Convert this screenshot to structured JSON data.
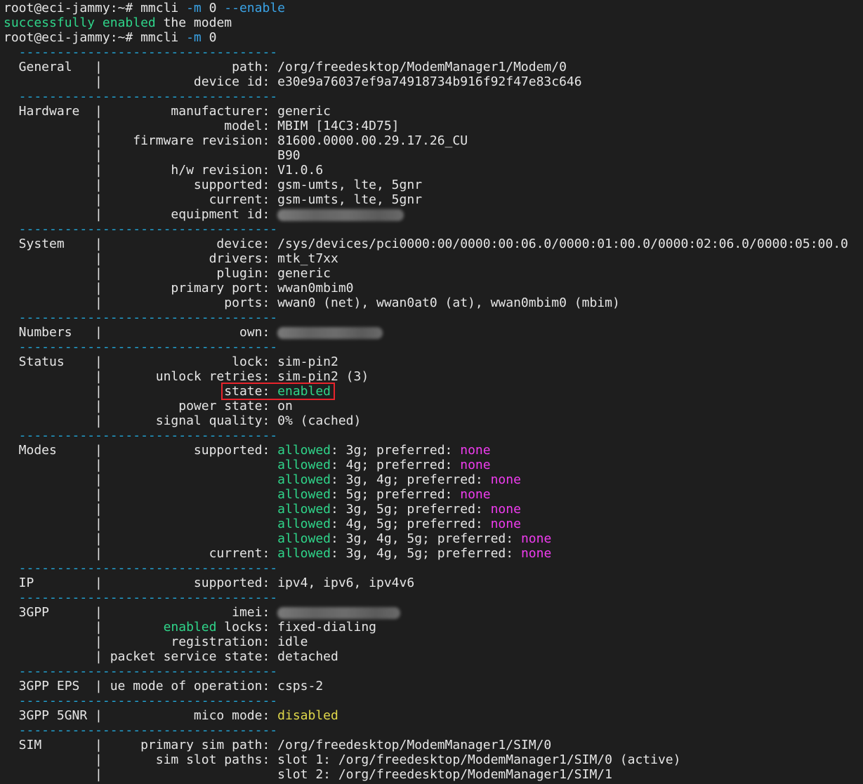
{
  "window": {
    "type": "terminal"
  },
  "colors": {
    "background": "#1e1e1e",
    "text": "#e6e6e6",
    "separator": "#22a5d6",
    "green": "#2fd58a",
    "blue": "#3aa3e6",
    "magenta": "#f03cf0",
    "yellow": "#e0d84a",
    "highlight_box": "#e8242c"
  },
  "separator_text": "  ----------------------------------",
  "lines": [
    {
      "s": [
        {
          "t": "root@eci-jammy:~# mmcli ",
          "c": "default"
        },
        {
          "t": "-m",
          "c": "blue"
        },
        {
          "t": " 0 ",
          "c": "default"
        },
        {
          "t": "--enable",
          "c": "blue"
        }
      ]
    },
    {
      "s": [
        {
          "t": "successfully enabled",
          "c": "green"
        },
        {
          "t": " the modem",
          "c": "default"
        }
      ]
    },
    {
      "s": [
        {
          "t": "root@eci-jammy:~# mmcli ",
          "c": "default"
        },
        {
          "t": "-m",
          "c": "blue"
        },
        {
          "t": " 0",
          "c": "default"
        }
      ]
    },
    {
      "sep": true
    },
    {
      "s": [
        {
          "t": "  General   |                 path: /org/freedesktop/ModemManager1/Modem/0",
          "c": "default"
        }
      ]
    },
    {
      "s": [
        {
          "t": "            |            device id: e30e9a76037ef9a74918734b916f92f47e83c646",
          "c": "default"
        }
      ]
    },
    {
      "sep": true
    },
    {
      "s": [
        {
          "t": "  Hardware  |         manufacturer: generic",
          "c": "default"
        }
      ]
    },
    {
      "s": [
        {
          "t": "            |                model: MBIM [14C3:4D75]",
          "c": "default"
        }
      ]
    },
    {
      "s": [
        {
          "t": "            |    firmware revision: 81600.0000.00.29.17.26_CU",
          "c": "default"
        }
      ]
    },
    {
      "s": [
        {
          "t": "            |                       B90",
          "c": "default"
        }
      ]
    },
    {
      "s": [
        {
          "t": "            |         h/w revision: V1.0.6",
          "c": "default"
        }
      ]
    },
    {
      "s": [
        {
          "t": "            |            supported: gsm-umts, lte, 5gnr",
          "c": "default"
        }
      ]
    },
    {
      "s": [
        {
          "t": "            |              current: gsm-umts, lte, 5gnr",
          "c": "default"
        }
      ]
    },
    {
      "s": [
        {
          "t": "            |         equipment id: ",
          "c": "default"
        },
        {
          "redact": true,
          "w": 180
        }
      ]
    },
    {
      "sep": true
    },
    {
      "s": [
        {
          "t": "  System    |               device: /sys/devices/pci0000:00/0000:00:06.0/0000:01:00.0/0000:02:06.0/0000:05:00.0",
          "c": "default"
        }
      ]
    },
    {
      "s": [
        {
          "t": "            |              drivers: mtk_t7xx",
          "c": "default"
        }
      ]
    },
    {
      "s": [
        {
          "t": "            |               plugin: generic",
          "c": "default"
        }
      ]
    },
    {
      "s": [
        {
          "t": "            |         primary port: wwan0mbim0",
          "c": "default"
        }
      ]
    },
    {
      "s": [
        {
          "t": "            |                ports: wwan0 (net), wwan0at0 (at), wwan0mbim0 (mbim)",
          "c": "default"
        }
      ]
    },
    {
      "sep": true
    },
    {
      "s": [
        {
          "t": "  Numbers   |                  own: ",
          "c": "default"
        },
        {
          "redact": true,
          "w": 150
        }
      ]
    },
    {
      "sep": true
    },
    {
      "s": [
        {
          "t": "  Status    |                 lock: sim-pin2",
          "c": "default"
        }
      ]
    },
    {
      "s": [
        {
          "t": "            |       unlock retries: sim-pin2 (3)",
          "c": "default"
        }
      ]
    },
    {
      "s": [
        {
          "t": "            |                state: ",
          "c": "default"
        },
        {
          "t": "enabled",
          "c": "green"
        }
      ],
      "highlight": true
    },
    {
      "s": [
        {
          "t": "            |          power state: on",
          "c": "default"
        }
      ]
    },
    {
      "s": [
        {
          "t": "            |       signal quality: 0% (cached)",
          "c": "default"
        }
      ]
    },
    {
      "sep": true
    },
    {
      "s": [
        {
          "t": "  Modes     |            supported: ",
          "c": "default"
        },
        {
          "t": "allowed",
          "c": "green"
        },
        {
          "t": ": 3g; preferred: ",
          "c": "default"
        },
        {
          "t": "none",
          "c": "magenta"
        }
      ]
    },
    {
      "s": [
        {
          "t": "            |                       ",
          "c": "default"
        },
        {
          "t": "allowed",
          "c": "green"
        },
        {
          "t": ": 4g; preferred: ",
          "c": "default"
        },
        {
          "t": "none",
          "c": "magenta"
        }
      ]
    },
    {
      "s": [
        {
          "t": "            |                       ",
          "c": "default"
        },
        {
          "t": "allowed",
          "c": "green"
        },
        {
          "t": ": 3g, 4g; preferred: ",
          "c": "default"
        },
        {
          "t": "none",
          "c": "magenta"
        }
      ]
    },
    {
      "s": [
        {
          "t": "            |                       ",
          "c": "default"
        },
        {
          "t": "allowed",
          "c": "green"
        },
        {
          "t": ": 5g; preferred: ",
          "c": "default"
        },
        {
          "t": "none",
          "c": "magenta"
        }
      ]
    },
    {
      "s": [
        {
          "t": "            |                       ",
          "c": "default"
        },
        {
          "t": "allowed",
          "c": "green"
        },
        {
          "t": ": 3g, 5g; preferred: ",
          "c": "default"
        },
        {
          "t": "none",
          "c": "magenta"
        }
      ]
    },
    {
      "s": [
        {
          "t": "            |                       ",
          "c": "default"
        },
        {
          "t": "allowed",
          "c": "green"
        },
        {
          "t": ": 4g, 5g; preferred: ",
          "c": "default"
        },
        {
          "t": "none",
          "c": "magenta"
        }
      ]
    },
    {
      "s": [
        {
          "t": "            |                       ",
          "c": "default"
        },
        {
          "t": "allowed",
          "c": "green"
        },
        {
          "t": ": 3g, 4g, 5g; preferred: ",
          "c": "default"
        },
        {
          "t": "none",
          "c": "magenta"
        }
      ]
    },
    {
      "s": [
        {
          "t": "            |              current: ",
          "c": "default"
        },
        {
          "t": "allowed",
          "c": "green"
        },
        {
          "t": ": 3g, 4g, 5g; preferred: ",
          "c": "default"
        },
        {
          "t": "none",
          "c": "magenta"
        }
      ]
    },
    {
      "sep": true
    },
    {
      "s": [
        {
          "t": "  IP        |            supported: ipv4, ipv6, ipv4v6",
          "c": "default"
        }
      ]
    },
    {
      "sep": true
    },
    {
      "s": [
        {
          "t": "  3GPP      |                 imei: ",
          "c": "default"
        },
        {
          "redact": true,
          "w": 175
        }
      ]
    },
    {
      "s": [
        {
          "t": "            |        ",
          "c": "default"
        },
        {
          "t": "enabled",
          "c": "green"
        },
        {
          "t": " locks: fixed-dialing",
          "c": "default"
        }
      ]
    },
    {
      "s": [
        {
          "t": "            |         registration: idle",
          "c": "default"
        }
      ]
    },
    {
      "s": [
        {
          "t": "            | packet service state: detached",
          "c": "default"
        }
      ]
    },
    {
      "sep": true
    },
    {
      "s": [
        {
          "t": "  3GPP EPS  | ue mode of operation: csps-2",
          "c": "default"
        }
      ]
    },
    {
      "sep": true
    },
    {
      "s": [
        {
          "t": "  3GPP 5GNR |            mico mode: ",
          "c": "default"
        },
        {
          "t": "disabled",
          "c": "yellow"
        }
      ]
    },
    {
      "sep": true
    },
    {
      "s": [
        {
          "t": "  SIM       |     primary sim path: /org/freedesktop/ModemManager1/SIM/0",
          "c": "default"
        }
      ]
    },
    {
      "s": [
        {
          "t": "            |       sim slot paths: slot 1: /org/freedesktop/ModemManager1/SIM/0 (active)",
          "c": "default"
        }
      ]
    },
    {
      "s": [
        {
          "t": "            |                       slot 2: /org/freedesktop/ModemManager1/SIM/1",
          "c": "default"
        }
      ]
    }
  ]
}
